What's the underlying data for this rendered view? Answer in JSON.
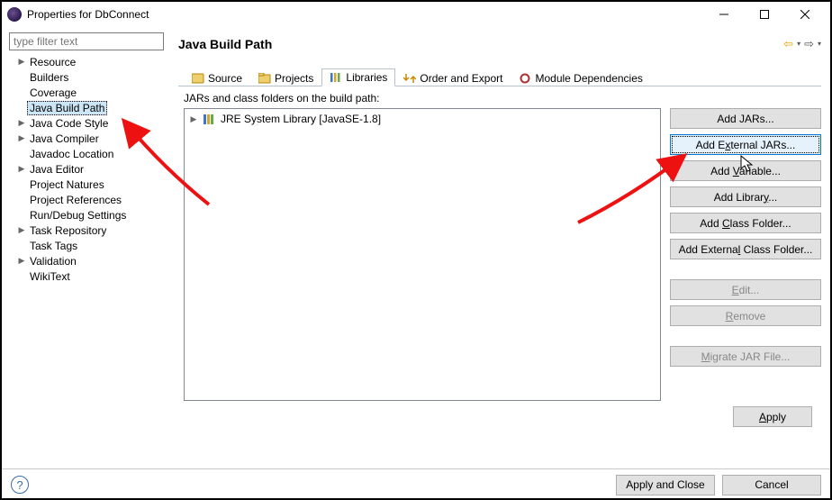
{
  "window": {
    "title": "Properties for DbConnect"
  },
  "sidebar": {
    "filter_placeholder": "type filter text",
    "items": [
      {
        "label": "Resource",
        "expandable": true
      },
      {
        "label": "Builders",
        "expandable": false
      },
      {
        "label": "Coverage",
        "expandable": false
      },
      {
        "label": "Java Build Path",
        "expandable": false,
        "selected": true
      },
      {
        "label": "Java Code Style",
        "expandable": true
      },
      {
        "label": "Java Compiler",
        "expandable": true
      },
      {
        "label": "Javadoc Location",
        "expandable": false
      },
      {
        "label": "Java Editor",
        "expandable": true
      },
      {
        "label": "Project Natures",
        "expandable": false
      },
      {
        "label": "Project References",
        "expandable": false
      },
      {
        "label": "Run/Debug Settings",
        "expandable": false
      },
      {
        "label": "Task Repository",
        "expandable": true
      },
      {
        "label": "Task Tags",
        "expandable": false
      },
      {
        "label": "Validation",
        "expandable": true
      },
      {
        "label": "WikiText",
        "expandable": false
      }
    ]
  },
  "page": {
    "heading": "Java Build Path",
    "tabs": [
      {
        "label": "Source"
      },
      {
        "label": "Projects"
      },
      {
        "label": "Libraries",
        "active": true
      },
      {
        "label": "Order and Export"
      },
      {
        "label": "Module Dependencies"
      }
    ],
    "subhead": "JARs and class folders on the build path:",
    "tree": {
      "item0": "JRE System Library [JavaSE-1.8]"
    },
    "buttons": {
      "add_jars": "Add JARs...",
      "add_external_jars_pre": "Add E",
      "add_external_jars_u": "x",
      "add_external_jars_post": "ternal JARs...",
      "add_variable_pre": "Add ",
      "add_variable_u": "V",
      "add_variable_post": "ariable...",
      "add_library_pre": "Add Librar",
      "add_library_u": "y",
      "add_library_post": "...",
      "add_class_folder_pre": "Add ",
      "add_class_folder_u": "C",
      "add_class_folder_post": "lass Folder...",
      "add_ext_class_folder_pre": "Add Externa",
      "add_ext_class_folder_u": "l",
      "add_ext_class_folder_post": " Class Folder...",
      "edit_u": "E",
      "edit_post": "dit...",
      "remove_u": "R",
      "remove_post": "emove",
      "migrate_u": "M",
      "migrate_post": "igrate JAR File...",
      "apply_pre": "",
      "apply_u": "A",
      "apply_post": "pply"
    }
  },
  "footer": {
    "apply_close": "Apply and Close",
    "cancel": "Cancel"
  }
}
